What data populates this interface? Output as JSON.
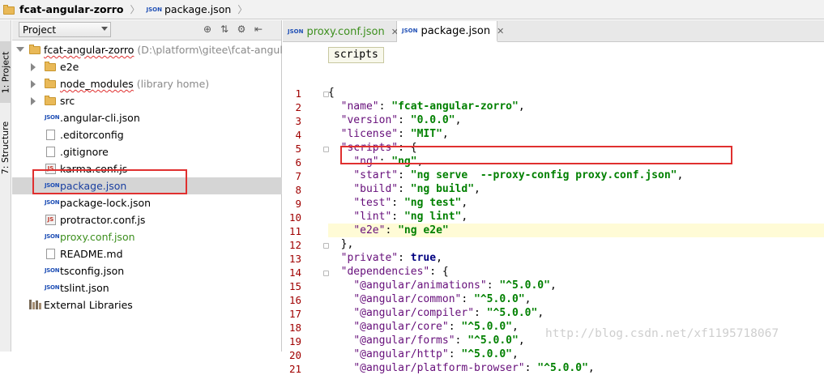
{
  "breadcrumb": {
    "root": "fcat-angular-zorro",
    "file": "package.json",
    "file_icon": "JSON"
  },
  "toolstrip": {
    "project_tab": "1: Project",
    "structure_tab": "7: Structure"
  },
  "project_panel": {
    "view_selector": "Project",
    "header_icons": [
      "target-icon",
      "collapse-icon",
      "settings-icon",
      "hide-icon"
    ],
    "root": {
      "name": "fcat-angular-zorro",
      "path": "(D:\\platform\\gitee\\fcat-angular-"
    },
    "folders": [
      {
        "name": "e2e",
        "note": ""
      },
      {
        "name": "node_modules",
        "note": "(library home)"
      },
      {
        "name": "src",
        "note": ""
      }
    ],
    "files": [
      {
        "name": ".angular-cli.json",
        "type": "json"
      },
      {
        "name": ".editorconfig",
        "type": "text"
      },
      {
        "name": ".gitignore",
        "type": "text"
      },
      {
        "name": "karma.conf.js",
        "type": "js"
      },
      {
        "name": "package.json",
        "type": "json"
      },
      {
        "name": "package-lock.json",
        "type": "json"
      },
      {
        "name": "protractor.conf.js",
        "type": "js"
      },
      {
        "name": "proxy.conf.json",
        "type": "json"
      },
      {
        "name": "README.md",
        "type": "text"
      },
      {
        "name": "tsconfig.json",
        "type": "json"
      },
      {
        "name": "tslint.json",
        "type": "json"
      }
    ],
    "external": "External Libraries",
    "selected_file": "package.json"
  },
  "editor": {
    "tabs": [
      {
        "label": "proxy.conf.json",
        "icon": "JSON",
        "active": false
      },
      {
        "label": "package.json",
        "icon": "JSON",
        "active": true
      }
    ],
    "breadcrumb_popup": "scripts",
    "line_numbers": [
      "1",
      "2",
      "3",
      "4",
      "5",
      "6",
      "7",
      "8",
      "9",
      "10",
      "11",
      "12",
      "13",
      "14",
      "15",
      "16",
      "17",
      "18",
      "19",
      "20",
      "21"
    ],
    "highlighted_line": "11",
    "lines": [
      "{",
      "  \"name\": \"fcat-angular-zorro\",",
      "  \"version\": \"0.0.0\",",
      "  \"license\": \"MIT\",",
      "  \"scripts\": {",
      "    \"ng\": \"ng\",",
      "    \"start\": \"ng serve  --proxy-config proxy.conf.json\",",
      "    \"build\": \"ng build\",",
      "    \"test\": \"ng test\",",
      "    \"lint\": \"ng lint\",",
      "    \"e2e\": \"ng e2e\"",
      "  },",
      "  \"private\": true,",
      "  \"dependencies\": {",
      "    \"@angular/animations\": \"^5.0.0\",",
      "    \"@angular/common\": \"^5.0.0\",",
      "    \"@angular/compiler\": \"^5.0.0\",",
      "    \"@angular/core\": \"^5.0.0\",",
      "    \"@angular/forms\": \"^5.0.0\",",
      "    \"@angular/http\": \"^5.0.0\",",
      "    \"@angular/platform-browser\": \"^5.0.0\","
    ]
  },
  "watermark": "http://blog.csdn.net/xf1195718067",
  "colors": {
    "json_key": "#660e7a",
    "json_string": "#008000",
    "line_number": "#a00000",
    "annotation_box": "#e0302f"
  }
}
